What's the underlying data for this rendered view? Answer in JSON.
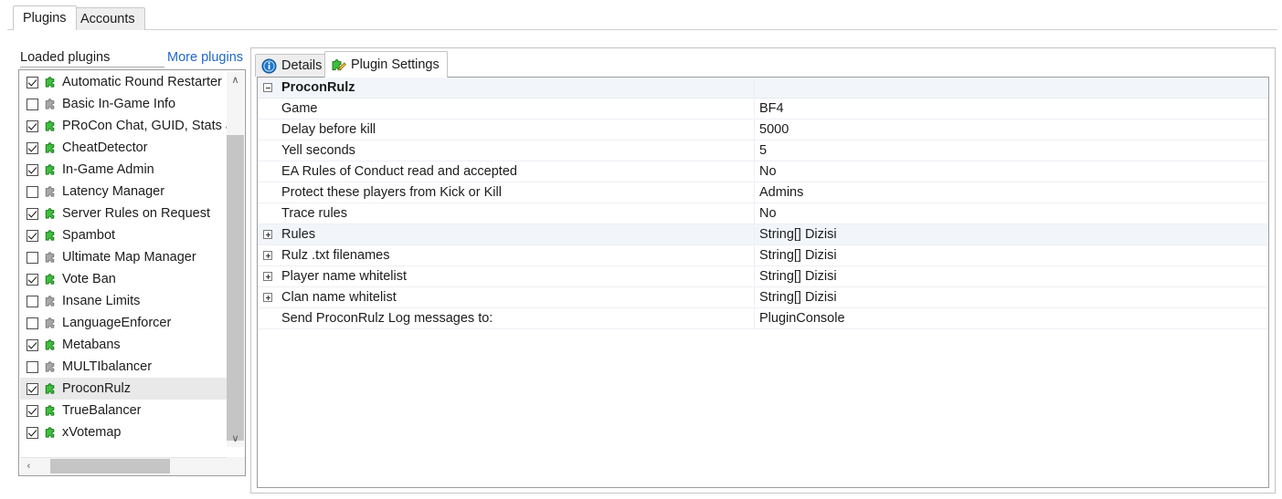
{
  "window_tabs": [
    {
      "label": "Plugins",
      "active": true
    },
    {
      "label": "Accounts",
      "active": false
    }
  ],
  "left_pane": {
    "title": "Loaded plugins",
    "more_link": "More plugins",
    "plugins": [
      {
        "name": "Automatic Round Restarter",
        "checked": true,
        "enabled": true,
        "selected": false
      },
      {
        "name": "Basic In-Game Info",
        "checked": false,
        "enabled": false,
        "selected": false
      },
      {
        "name": "PRoCon Chat, GUID, Stats a",
        "checked": true,
        "enabled": true,
        "selected": false
      },
      {
        "name": "CheatDetector",
        "checked": true,
        "enabled": true,
        "selected": false
      },
      {
        "name": "In-Game Admin",
        "checked": true,
        "enabled": true,
        "selected": false
      },
      {
        "name": "Latency Manager",
        "checked": false,
        "enabled": false,
        "selected": false
      },
      {
        "name": "Server Rules on Request",
        "checked": true,
        "enabled": true,
        "selected": false
      },
      {
        "name": "Spambot",
        "checked": true,
        "enabled": true,
        "selected": false
      },
      {
        "name": "Ultimate Map Manager",
        "checked": false,
        "enabled": false,
        "selected": false
      },
      {
        "name": "Vote Ban",
        "checked": true,
        "enabled": true,
        "selected": false
      },
      {
        "name": "Insane Limits",
        "checked": false,
        "enabled": false,
        "selected": false
      },
      {
        "name": "LanguageEnforcer",
        "checked": false,
        "enabled": false,
        "selected": false
      },
      {
        "name": "Metabans",
        "checked": true,
        "enabled": true,
        "selected": false
      },
      {
        "name": "MULTIbalancer",
        "checked": false,
        "enabled": false,
        "selected": false
      },
      {
        "name": "ProconRulz",
        "checked": true,
        "enabled": true,
        "selected": true
      },
      {
        "name": "TrueBalancer",
        "checked": true,
        "enabled": true,
        "selected": false
      },
      {
        "name": "xVotemap",
        "checked": true,
        "enabled": true,
        "selected": false
      }
    ]
  },
  "right_pane": {
    "tabs": [
      {
        "label": "Details",
        "icon": "info-icon",
        "active": false
      },
      {
        "label": "Plugin Settings",
        "icon": "plugin-edit-icon",
        "active": true
      }
    ],
    "settings_rows": [
      {
        "name": "ProconRulz",
        "value": "",
        "expander": "minus",
        "header": true,
        "tint": true
      },
      {
        "name": "Game",
        "value": "BF4",
        "expander": "none",
        "header": false,
        "tint": false
      },
      {
        "name": "Delay before kill",
        "value": "5000",
        "expander": "none",
        "header": false,
        "tint": false
      },
      {
        "name": "Yell seconds",
        "value": "5",
        "expander": "none",
        "header": false,
        "tint": false
      },
      {
        "name": "EA Rules of Conduct read and accepted",
        "value": "No",
        "expander": "none",
        "header": false,
        "tint": false
      },
      {
        "name": "Protect these players from Kick or Kill",
        "value": "Admins",
        "expander": "none",
        "header": false,
        "tint": false
      },
      {
        "name": "Trace rules",
        "value": "No",
        "expander": "none",
        "header": false,
        "tint": false
      },
      {
        "name": "Rules",
        "value": "String[] Dizisi",
        "expander": "plus",
        "header": false,
        "tint": true
      },
      {
        "name": "Rulz .txt filenames",
        "value": "String[] Dizisi",
        "expander": "plus",
        "header": false,
        "tint": false
      },
      {
        "name": "Player name whitelist",
        "value": "String[] Dizisi",
        "expander": "plus",
        "header": false,
        "tint": false
      },
      {
        "name": "Clan name whitelist",
        "value": "String[] Dizisi",
        "expander": "plus",
        "header": false,
        "tint": false
      },
      {
        "name": "Send ProconRulz Log messages to:",
        "value": "PluginConsole",
        "expander": "none",
        "header": false,
        "tint": false
      }
    ]
  },
  "colors": {
    "link": "#2266cc",
    "row_tint": "#f2f6fb",
    "selection": "#e9e9e9",
    "plugin_enabled": "#3fbf3f",
    "plugin_disabled": "#a8a8a8"
  },
  "scrollbars": {
    "vertical_arrow_up": "∧",
    "vertical_arrow_down": "∨",
    "horizontal_arrow_left": "‹",
    "horizontal_arrow_right": "›"
  }
}
